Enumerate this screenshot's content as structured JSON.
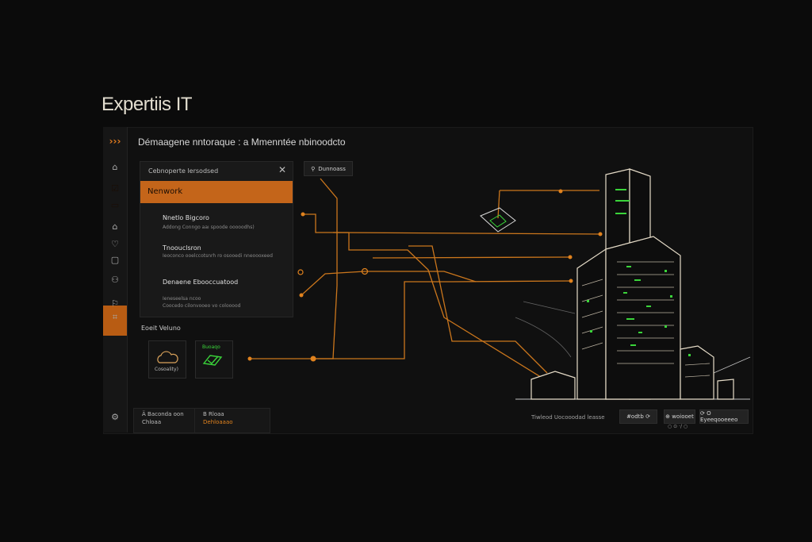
{
  "brand": "Expertiis IT",
  "window": {
    "title": "Démaagene nntoraque : a Mmenntée nbinoodcto"
  },
  "search": {
    "label": "Dunnoass"
  },
  "panel": {
    "header": "Cebnoperte lersodsed",
    "close_icon": "close-icon",
    "selected": "Nenwork",
    "items": [
      {
        "title": "Nnetlo Bigcoro",
        "sub": "Addong Conngo aaı spoode ooooodhs)"
      },
      {
        "title": "Tnoouclsron",
        "sub": "Ieoconco ooelccotsnrh ro osooedi nneoooxeed"
      },
      {
        "title": "Denaene Ebooccuatood",
        "sub": "Ieneseelsa ncoo"
      },
      {
        "title": "",
        "sub": "Coocedo cilonvooeo vo colooood"
      }
    ]
  },
  "services": {
    "label": "Eoeit Veluno",
    "tiles": [
      {
        "icon": "cloud-icon",
        "label": "Cosoality)"
      },
      {
        "icon": "shield-check-icon",
        "label": "Buoaqo"
      }
    ]
  },
  "footer": {
    "card1": {
      "line1": "Ä Baconda oon",
      "line2": "Chloaa"
    },
    "card2": {
      "line1": "B Rloaa",
      "line2": "Dehloaaao"
    },
    "status": "Tiwleod Uocooodad leasse",
    "chips": [
      "#odtb  ⟳",
      "⊕ woiooet",
      "⟳ O Eyeeqooeeeo"
    ],
    "dots": "○ ⊙ ·/ ○"
  },
  "colors": {
    "accent": "#c4651a",
    "line": "#e0821e",
    "green": "#3ad43a"
  }
}
